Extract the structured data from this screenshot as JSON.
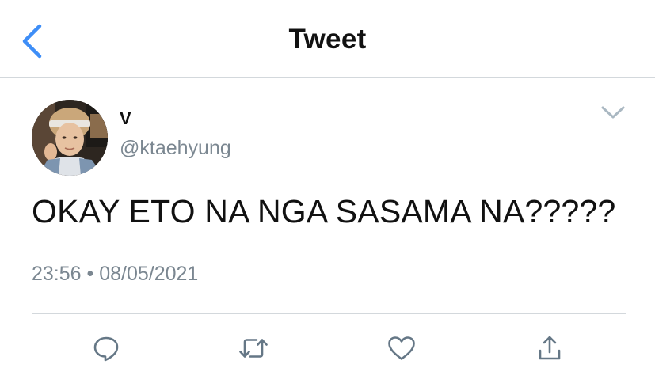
{
  "header": {
    "title": "Tweet",
    "back_icon": "chevron-left-icon"
  },
  "tweet": {
    "display_name": "V",
    "handle": "@ktaehyung",
    "text": "OKAY ETO NA NGA SASAMA NA?????",
    "timestamp": "23:56 • 08/05/2021",
    "menu_icon": "chevron-down-icon"
  },
  "actions": [
    {
      "name": "reply",
      "icon": "comment-icon"
    },
    {
      "name": "retweet",
      "icon": "retweet-icon"
    },
    {
      "name": "like",
      "icon": "heart-icon"
    },
    {
      "name": "share",
      "icon": "share-icon"
    }
  ],
  "colors": {
    "accent": "#1da1f2",
    "icon_gray": "#657786",
    "secondary_text": "#7b8791",
    "divider": "#d3d8dc"
  }
}
